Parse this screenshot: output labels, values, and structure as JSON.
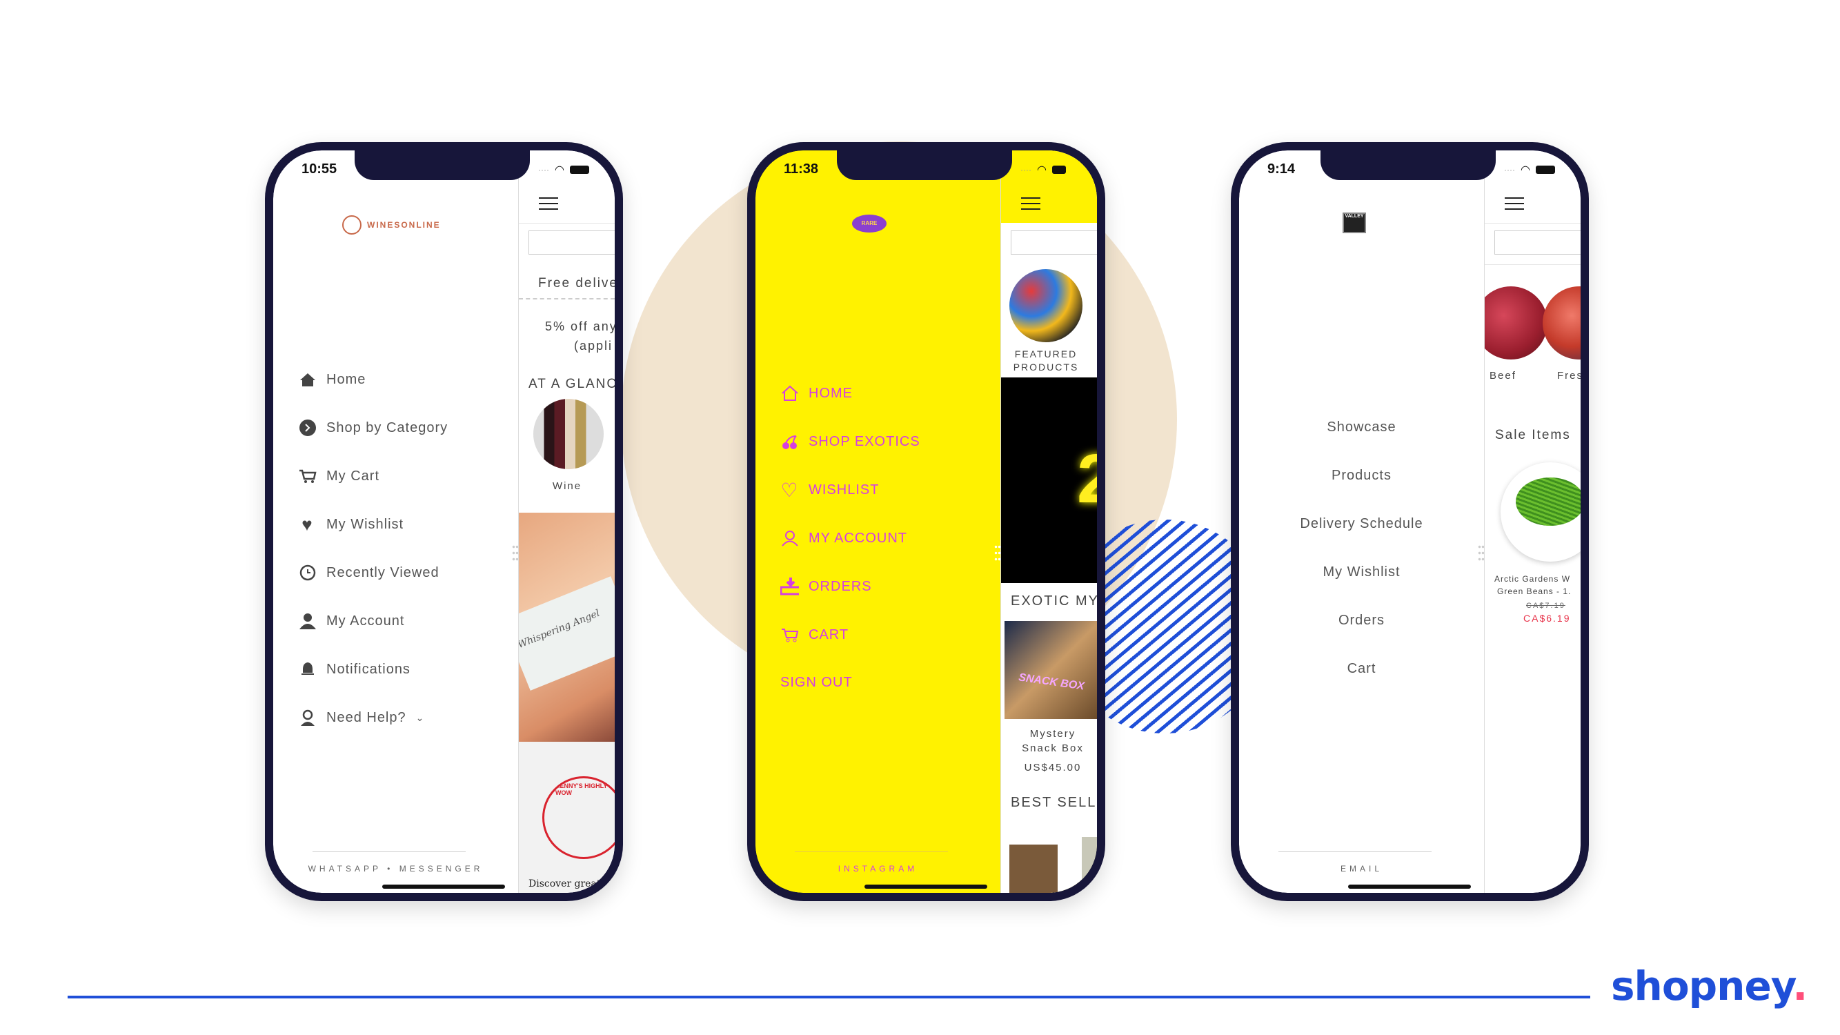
{
  "colors": {
    "frame": "#17163a",
    "brand_blue": "#1f4fd8",
    "beige": "#f2e4cf",
    "yellow": "#fff200",
    "magenta": "#d63fe0",
    "wine_accent": "#c8694a",
    "sale_red": "#e8334a"
  },
  "brand": {
    "name": "shopney",
    "dot": "."
  },
  "phones": [
    {
      "time": "10:55",
      "logo": "WINESONLINE",
      "menu": [
        {
          "label": "Home",
          "icon": "home-icon"
        },
        {
          "label": "Shop by Category",
          "icon": "chevron-circle-icon"
        },
        {
          "label": "My Cart",
          "icon": "cart-icon"
        },
        {
          "label": "My Wishlist",
          "icon": "heart-icon"
        },
        {
          "label": "Recently Viewed",
          "icon": "clock-icon"
        },
        {
          "label": "My Account",
          "icon": "user-icon"
        },
        {
          "label": "Notifications",
          "icon": "bell-icon"
        },
        {
          "label": "Need Help?",
          "icon": "support-icon"
        }
      ],
      "footer": "WHATSAPP • MESSENGER",
      "content": {
        "banner1": "Free delive",
        "banner2": "5% off any",
        "banner3": "(appli",
        "section": "AT A GLANC",
        "category": "Wine",
        "label_script": "Whispering Angel",
        "stamp": "KENNY'S HIGHLY RE · WOW",
        "caption": "Discover great"
      }
    },
    {
      "time": "11:38",
      "logo": "RARE Munchies",
      "menu": [
        {
          "label": "HOME",
          "icon": "home-icon"
        },
        {
          "label": "SHOP EXOTICS",
          "icon": "cherry-icon"
        },
        {
          "label": "WISHLIST",
          "icon": "heart-icon"
        },
        {
          "label": "MY ACCOUNT",
          "icon": "user-icon"
        },
        {
          "label": "ORDERS",
          "icon": "inbox-download-icon"
        },
        {
          "label": "CART",
          "icon": "cart-icon"
        }
      ],
      "sign_out": "SIGN OUT",
      "footer": "INSTAGRAM",
      "content": {
        "featured1": "FEATURED",
        "featured2": "PRODUCTS",
        "banner_digit": "2",
        "section": "EXOTIC MYS",
        "product_name1": "Mystery",
        "product_name2": "Snack Box",
        "product_image_text": "SNACK BOX",
        "price": "US$45.00",
        "section2": "BEST SELLIN"
      }
    },
    {
      "time": "9:14",
      "logo": "VALLEY",
      "menu": [
        {
          "label": "Showcase"
        },
        {
          "label": "Products"
        },
        {
          "label": "Delivery Schedule"
        },
        {
          "label": "My Wishlist"
        },
        {
          "label": "Orders"
        },
        {
          "label": "Cart"
        }
      ],
      "footer": "EMAIL",
      "content": {
        "cat1": "Beef",
        "cat2": "Fres",
        "section": "Sale Items",
        "product1": "Arctic Gardens W",
        "product2": "Green Beans - 1.",
        "old_price": "CA$7.19",
        "price": "CA$6.19"
      }
    }
  ]
}
